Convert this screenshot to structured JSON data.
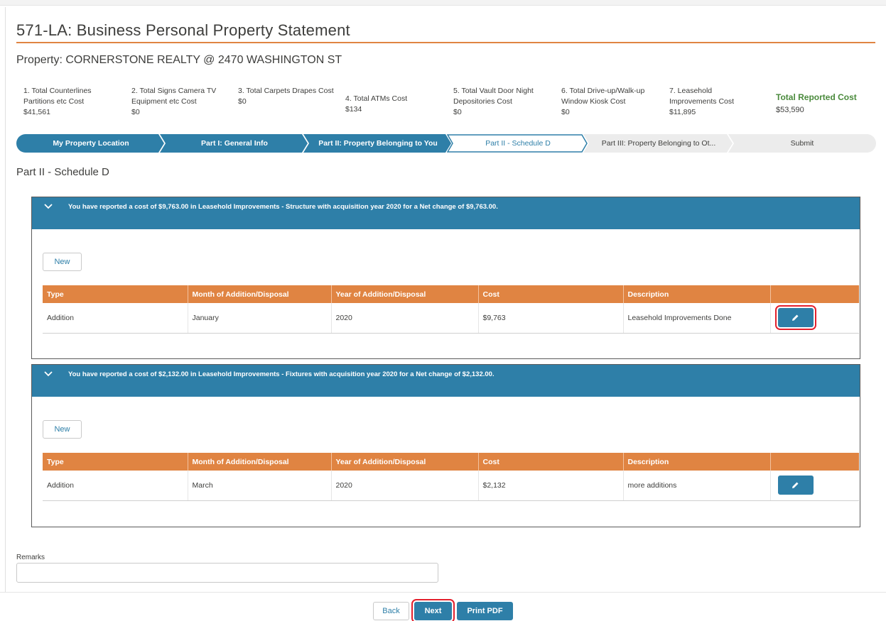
{
  "page": {
    "title": "571-LA: Business Personal Property Statement",
    "property": "Property: CORNERSTONE REALTY @ 2470 WASHINGTON ST"
  },
  "summary": [
    {
      "label": "1. Total Counterlines Partitions etc Cost",
      "value": "$41,561"
    },
    {
      "label": "2. Total Signs Camera TV Equipment etc Cost",
      "value": "$0"
    },
    {
      "label": "3. Total Carpets Drapes Cost",
      "value": "$0"
    },
    {
      "label": "4. Total ATMs Cost",
      "value": "$134"
    },
    {
      "label": "5. Total Vault Door Night Depositories Cost",
      "value": "$0"
    },
    {
      "label": "6. Total Drive-up/Walk-up Window Kiosk Cost",
      "value": "$0"
    },
    {
      "label": "7. Leasehold Improvements Cost",
      "value": "$11,895"
    },
    {
      "label": "Total Reported Cost",
      "value": "$53,590"
    }
  ],
  "path": [
    {
      "label": "My Property Location",
      "state": "complete"
    },
    {
      "label": "Part I: General Info",
      "state": "complete"
    },
    {
      "label": "Part II: Property Belonging to You",
      "state": "complete"
    },
    {
      "label": "Part II - Schedule D",
      "state": "current"
    },
    {
      "label": "Part III: Property Belonging to Ot...",
      "state": "incomplete"
    },
    {
      "label": "Submit",
      "state": "incomplete"
    }
  ],
  "section_title": "Part II - Schedule D",
  "table_headers": [
    "Type",
    "Month of Addition/Disposal",
    "Year of Addition/Disposal",
    "Cost",
    "Description"
  ],
  "accordions": [
    {
      "header": "You have reported a cost of $9,763.00 in Leasehold Improvements - Structure with acquisition year  2020 for a Net change of $9,763.00.",
      "new_label": "New",
      "row": {
        "type": "Addition",
        "month": "January",
        "year": "2020",
        "cost": "$9,763",
        "description": "Leasehold Improvements Done"
      }
    },
    {
      "header": "You have reported a cost of $2,132.00 in Leasehold Improvements - Fixtures with acquisition year  2020 for a Net change of $2,132.00.",
      "new_label": "New",
      "row": {
        "type": "Addition",
        "month": "March",
        "year": "2020",
        "cost": "$2,132",
        "description": "more additions"
      }
    }
  ],
  "remarks": {
    "label": "Remarks",
    "value": ""
  },
  "footer": {
    "back": "Back",
    "next": "Next",
    "print": "Print PDF"
  },
  "colors": {
    "brand": "#2e7fa8",
    "accent": "#e08442",
    "highlight": "#e3202c",
    "total_green": "#4a8a3c"
  },
  "icons": {
    "accordion_toggle": "chevron-down-icon",
    "edit": "pencil-icon"
  }
}
